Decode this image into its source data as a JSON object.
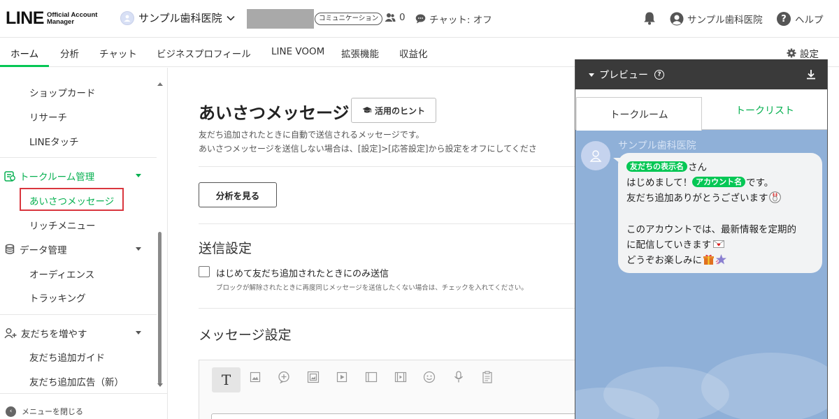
{
  "header": {
    "logo_main": "LINE",
    "logo_sub_1": "Official Account",
    "logo_sub_2": "Manager",
    "account_name": "サンプル歯科医院",
    "plan_badge": "コミュニケーション",
    "friends_count": "0",
    "chat_status": "チャット: オフ",
    "user_name": "サンプル歯科医院",
    "help_label": "ヘルプ"
  },
  "nav": {
    "tabs": [
      {
        "label": "ホーム"
      },
      {
        "label": "分析"
      },
      {
        "label": "チャット"
      },
      {
        "label": "ビジネスプロフィール"
      },
      {
        "label": "LINE VOOM"
      },
      {
        "label": "拡張機能"
      },
      {
        "label": "収益化"
      }
    ],
    "settings_label": "設定",
    "accent": "#06c755"
  },
  "sidebar": {
    "items_top": [
      "ショップカード",
      "リサーチ",
      "LINEタッチ"
    ],
    "section_talkroom": "トークルーム管理",
    "talkroom_items": [
      "あいさつメッセージ",
      "リッチメニュー"
    ],
    "section_data": "データ管理",
    "data_items": [
      "オーディエンス",
      "トラッキング"
    ],
    "section_friends": "友だちを増やす",
    "friends_items": [
      "友だち追加ガイド",
      "友だち追加広告（新）"
    ],
    "close_menu": "メニューを閉じる"
  },
  "main": {
    "title": "あいさつメッセージ",
    "hint_button": "活用のヒント",
    "desc_1": "友だち追加されたときに自動で送信されるメッセージです。",
    "desc_2": "あいさつメッセージを送信しない場合は、[設定]>[応答設定]から設定をオフにしてくださ",
    "analysis_button": "分析を見る",
    "send_settings_heading": "送信設定",
    "checkbox_label": "はじめて友だち追加されたときにのみ送信",
    "checkbox_help": "ブロックが解除されたときに再度同じメッセージを送信したくない場合は、チェックを入れてください。",
    "checkbox_checked": false,
    "message_settings_heading": "メッセージ設定",
    "toolbar_text_icon": "T"
  },
  "preview": {
    "title": "プレビュー",
    "tab_talkroom": "トークルーム",
    "tab_talklist": "トークリスト",
    "sender": "サンプル歯科医院",
    "tag_friend_name": "友だちの表示名",
    "line1_suffix": "さん",
    "line2_prefix": "はじめまして！",
    "tag_account_name": "アカウント名",
    "line2_suffix": "です。",
    "line3": "友だち追加ありがとうございます",
    "line4": "このアカウントでは、最新情報を定期的",
    "line5": "に配信していきます",
    "line6": "どうぞお楽しみに"
  }
}
